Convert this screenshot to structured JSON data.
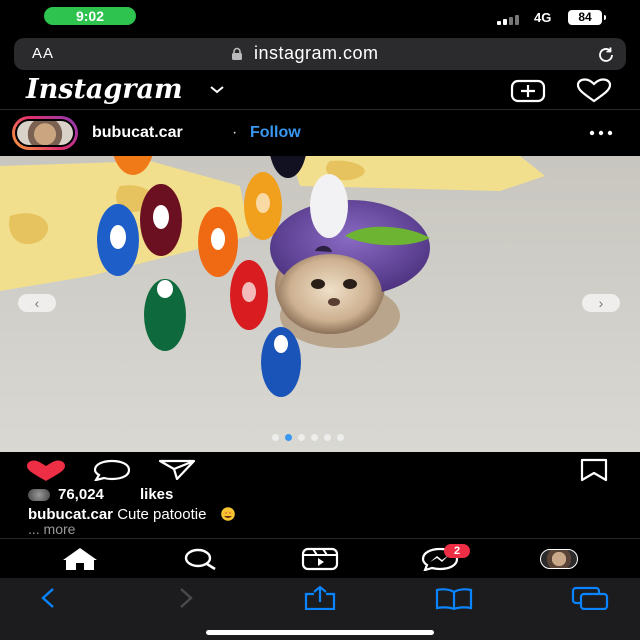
{
  "status_bar": {
    "time": "9:02",
    "network": "4G",
    "battery": "84",
    "time_pill_color": "#2ec24f"
  },
  "safari": {
    "text_size_label": "AA",
    "url": "instagram.com",
    "icons": [
      "lock-icon",
      "reload-icon",
      "back-icon",
      "forward-icon",
      "share-icon",
      "bookmarks-icon",
      "tabs-icon"
    ]
  },
  "ig_header": {
    "logo": "Instagram",
    "icons": [
      "chevron-down-icon",
      "new-post-icon",
      "activity-heart-icon"
    ]
  },
  "post": {
    "username": "bubucat.car",
    "separator": "·",
    "follow_label": "Follow",
    "carousel": {
      "total": 6,
      "active_index": 1
    },
    "likes_count": "76,024",
    "likes_label": "likes",
    "caption_user": "bubucat.car",
    "caption_text": "Cute patootie",
    "caption_emoji": "heart-eyes-emoji",
    "more_label": "... more",
    "action_icons": [
      "like-heart-icon",
      "comment-icon",
      "share-send-icon",
      "save-bookmark-icon"
    ]
  },
  "ig_nav": {
    "items": [
      "home-icon",
      "search-icon",
      "reels-icon",
      "messenger-icon",
      "profile-avatar"
    ],
    "messages_badge": "2"
  },
  "colors": {
    "accent_blue": "#3897f0",
    "like_red": "#ed2e44",
    "safari_blue": "#0a84ff"
  }
}
